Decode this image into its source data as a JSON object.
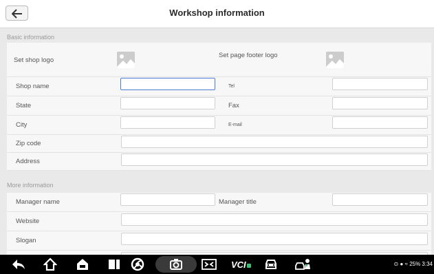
{
  "header": {
    "title": "Workshop information"
  },
  "sections": {
    "basic": "Basic information",
    "more": "More information"
  },
  "fields": {
    "set_shop_logo": "Set shop logo",
    "set_footer_logo": "Set page footer logo",
    "shop_name": "Shop name",
    "tel": "Tel",
    "state": "State",
    "fax": "Fax",
    "city": "City",
    "email": "E-mail",
    "zip_code": "Zip code",
    "address": "Address",
    "manager_name": "Manager name",
    "manager_title": "Manager title",
    "website": "Website",
    "slogan": "Slogan"
  },
  "navbar": {
    "vci_label": "VCI",
    "status": "25% 3:34"
  },
  "colors": {
    "accent": "#4a7bd0",
    "nav_bg": "#000000",
    "vci_green": "#38c172"
  }
}
